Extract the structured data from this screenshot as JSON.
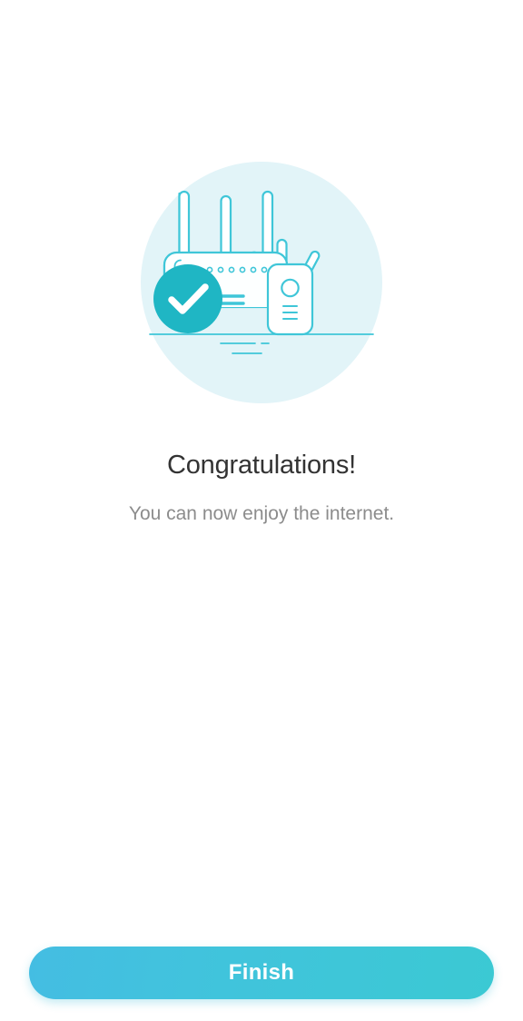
{
  "screen": {
    "name": "setup-complete",
    "background_color": "#ffffff"
  },
  "illustration": {
    "name": "router-extender-success-illustration",
    "circle_color": "#e2f4f8",
    "stroke_color": "#3fc6d8",
    "device_fill": "#ffffff",
    "badge_color": "#1fb6c4",
    "badge_check_color": "#ffffff",
    "led_count": 8,
    "antenna_count": 3,
    "alt": "Wi-Fi router and range extender with a success checkmark"
  },
  "content": {
    "title": "Congratulations!",
    "title_color": "#333333",
    "subtitle": "You can now enjoy the internet.",
    "subtitle_color": "#8c8c8c"
  },
  "footer": {
    "finish_label": "Finish",
    "button_gradient_start": "#44bde2",
    "button_gradient_end": "#3bc9d3",
    "button_text_color": "#ffffff"
  }
}
